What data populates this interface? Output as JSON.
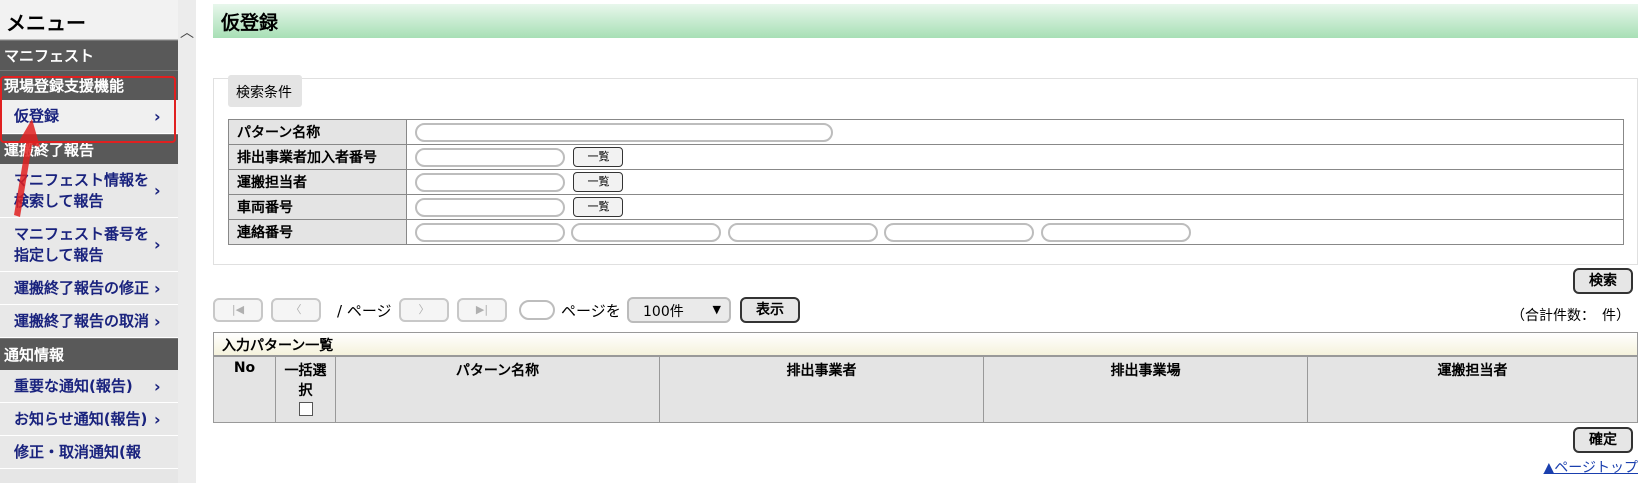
{
  "sidebar": {
    "menu_title": "メニュー",
    "sections": [
      {
        "label": "マニフェスト"
      },
      {
        "label": "現場登録支援機能"
      },
      {
        "label": "運搬終了報告"
      },
      {
        "label": "通知情報"
      }
    ],
    "items": {
      "kari_touroku": "仮登録",
      "search_report_1": "マニフェスト情報を",
      "search_report_2": "検索して報告",
      "number_report_1": "マニフェスト番号を",
      "number_report_2": "指定して報告",
      "fix_report": "運搬終了報告の修正",
      "cancel_report": "運搬終了報告の取消",
      "important_notice": "重要な通知(報告)",
      "info_notice": "お知らせ通知(報告)",
      "correction_notice": "修正・取消通知(報"
    },
    "chevron": "›"
  },
  "header": {
    "title": "仮登録"
  },
  "search": {
    "legend": "検索条件",
    "labels": {
      "pattern_name": "パターン名称",
      "discharger_no": "排出事業者加入者番号",
      "transport_person": "運搬担当者",
      "vehicle_no": "車両番号",
      "contact_no": "連絡番号"
    },
    "list_button": "一覧",
    "search_button": "検索"
  },
  "pager": {
    "first": "|◀",
    "prev": "〈",
    "next": "〉",
    "last": "▶|",
    "slash_page": "/ ページ",
    "page_wo": "ページを",
    "per_page": "100件",
    "show_button": "表示",
    "total": "（合計件数：　件）"
  },
  "list": {
    "title": "入力パターン一覧",
    "columns": {
      "no": "No",
      "bulk_select_1": "一括選",
      "bulk_select_2": "択",
      "pattern_name": "パターン名称",
      "discharger": "排出事業者",
      "discharge_site": "排出事業場",
      "transport_person": "運搬担当者"
    }
  },
  "confirm_button": "確定",
  "page_top_link": "▲ページトップ",
  "colors": {
    "header_green": "#a7dfb5",
    "highlight_red": "#e02020",
    "nav_text": "#1a237e",
    "section_bg": "#595959"
  }
}
